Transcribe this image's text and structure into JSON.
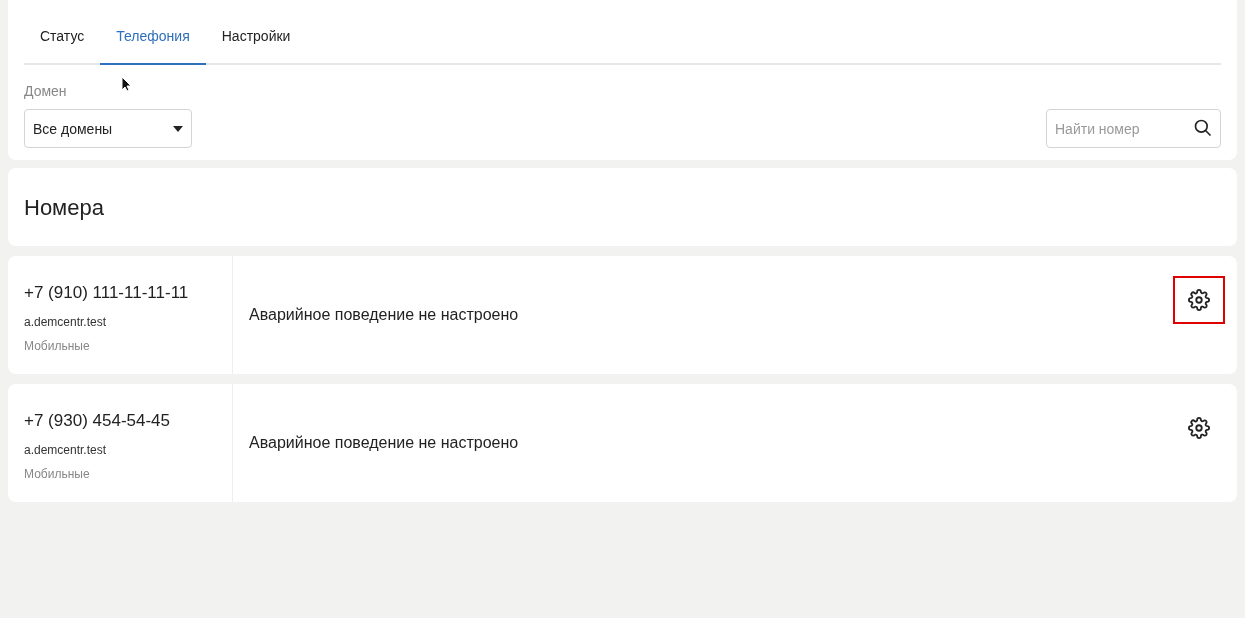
{
  "tabs": [
    {
      "label": "Статус",
      "selected": false
    },
    {
      "label": "Телефония",
      "selected": true
    },
    {
      "label": "Настройки",
      "selected": false
    }
  ],
  "domain_filter": {
    "label": "Домен",
    "value": "Все домены"
  },
  "search": {
    "placeholder": "Найти номер"
  },
  "section": {
    "title": "Номера"
  },
  "numbers": [
    {
      "phone": "+7 (910) 111-11-11-11",
      "domain": "a.demcentr.test",
      "type": "Мобильные",
      "status": "Аварийное поведение не настроено",
      "highlighted": true
    },
    {
      "phone": "+7 (930) 454-54-45",
      "domain": "a.demcentr.test",
      "type": "Мобильные",
      "status": "Аварийное поведение не настроено",
      "highlighted": false
    }
  ]
}
